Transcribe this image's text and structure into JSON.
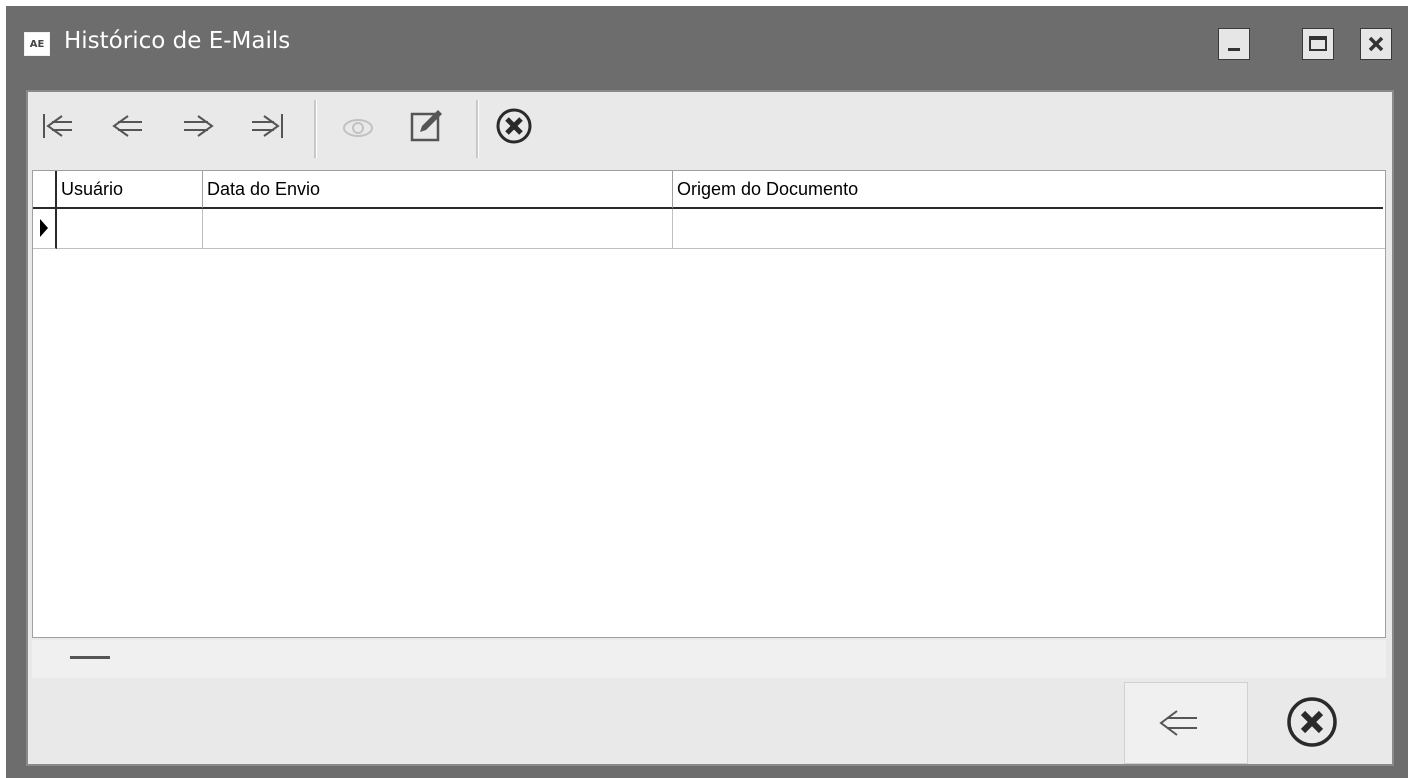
{
  "window": {
    "title": "Histórico de E-Mails",
    "app_icon_text": "AE",
    "controls": [
      "minimize-icon",
      "maximize-icon",
      "close-icon"
    ]
  },
  "toolbar": {
    "buttons": [
      {
        "name": "first-record",
        "icon": "first-arrow-icon"
      },
      {
        "name": "previous-record",
        "icon": "left-arrow-icon"
      },
      {
        "name": "next-record",
        "icon": "right-arrow-icon"
      },
      {
        "name": "last-record",
        "icon": "last-arrow-icon"
      },
      {
        "name": "view",
        "icon": "eye-icon",
        "disabled": true
      },
      {
        "name": "edit",
        "icon": "edit-icon"
      },
      {
        "name": "cancel",
        "icon": "cancel-x-icon"
      }
    ]
  },
  "grid": {
    "columns": [
      "Usuário",
      "Data do Envio",
      "Origem do Documento"
    ],
    "rows": [
      [
        "",
        "",
        ""
      ]
    ]
  },
  "footer": {
    "buttons": [
      {
        "name": "back",
        "icon": "back-arrow-icon"
      },
      {
        "name": "close",
        "icon": "cancel-x-icon"
      }
    ]
  }
}
